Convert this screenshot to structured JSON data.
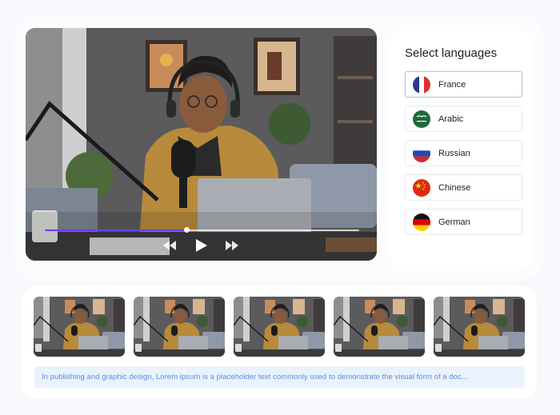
{
  "player": {
    "progress": 0.45,
    "rewind_icon": "rewind-icon",
    "play_icon": "play-icon",
    "forward_icon": "fast-forward-icon"
  },
  "languages": {
    "title": "Select languages",
    "selected": "France",
    "items": [
      {
        "label": "France",
        "flag": "flag-france-icon"
      },
      {
        "label": "Arabic",
        "flag": "flag-saudi-arabia-icon"
      },
      {
        "label": "Russian",
        "flag": "flag-russia-icon"
      },
      {
        "label": "Chinese",
        "flag": "flag-china-icon"
      },
      {
        "label": "German",
        "flag": "flag-germany-icon"
      }
    ]
  },
  "thumbnails": {
    "count": 5
  },
  "caption": {
    "text": "In publishing and graphic design, Lorem ipsum is a placeholder text commonly used to demonstrate the visual form of a doc..."
  },
  "colors": {
    "accent": "#6b3cf0",
    "caption_bg": "#eaf2fd",
    "caption_text": "#5a8fd6",
    "selected_border": "#aec2da"
  }
}
